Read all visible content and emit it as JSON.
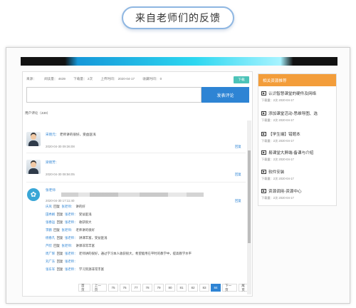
{
  "header": {
    "title": "来自老师们的反馈"
  },
  "meta": {
    "source": "来源：",
    "views": "阅读量： 4639",
    "downloads": "下载量： 2次",
    "upload_time": "上传时间： 2020-04-17",
    "likes": "收藏时间： 0",
    "download_btn": "下载"
  },
  "comment_box": {
    "submit": "发表评论"
  },
  "comments_count": "用户评论（430）",
  "comments": [
    {
      "name": "宋晓元：",
      "text": "老师讲的很好，受益匪浅",
      "time": "2020-04-30 09:36:08",
      "reply": "回复"
    },
    {
      "name": "梁晓芳：",
      "text": "",
      "time": "2020-04-30 08:56:05",
      "reply": "回复"
    }
  ],
  "featured": {
    "name": "张老师",
    "time": "2020-04-30 17:11:40",
    "reply": "回复",
    "replies": [
      {
        "user": "庆凤",
        "verb": "回复",
        "target": "张老师：",
        "text": "讲的好"
      },
      {
        "user": "田秀娟",
        "verb": "回复",
        "target": "张老师：",
        "text": "受益匪浅"
      },
      {
        "user": "张春运",
        "verb": "回复",
        "target": "张老师：",
        "text": "收获很大"
      },
      {
        "user": "李鹏",
        "verb": "回复",
        "target": "张老师：",
        "text": "老师讲的很好"
      },
      {
        "user": "杨春凡",
        "verb": "回复",
        "target": "张老师：",
        "text": "讲课丰富，受益匪浅"
      },
      {
        "user": "芦欣",
        "verb": "回复",
        "target": "张老师：",
        "text": "讲课非常丰富"
      },
      {
        "user": "周广辉",
        "verb": "回复",
        "target": "张老师：",
        "text": "老师讲的很好，通过学习本人收获很大，希望能用在平时的教学中，提高教学水平"
      },
      {
        "user": "刘广东",
        "verb": "回复",
        "target": "张老师：",
        "text": ""
      },
      {
        "user": "张东军",
        "verb": "回复",
        "target": "张老师：",
        "text": "学习资源非常丰富"
      }
    ]
  },
  "pagination": [
    "首页",
    "上一页",
    "75",
    "76",
    "77",
    "78",
    "79",
    "80",
    "81",
    "82",
    "83",
    "84",
    "下一页",
    "尾页"
  ],
  "pagination_active": "84",
  "sidebar": {
    "title": "相关资源推荐",
    "items": [
      {
        "title": "认识智慧课堂的硬件及网络",
        "meta": "下载量：2次  2020-04-17"
      },
      {
        "title": "添加课堂活动-思维导图、选",
        "meta": "下载量：2次  2020-04-17"
      },
      {
        "title": "【学生端】错题本",
        "meta": "下载量：2次  2020-04-17"
      },
      {
        "title": "易课堂大屏端-备课与介绍",
        "meta": "下载量：2次  2020-04-17"
      },
      {
        "title": "软件安装",
        "meta": "下载量：2次  2020-04-17"
      },
      {
        "title": "资源调用-资源中心",
        "meta": "下载量：2次  2020-04-17"
      }
    ]
  },
  "colors": {
    "accent": "#2e84d4",
    "orange": "#f39d3a",
    "teal": "#4cc3b8"
  }
}
